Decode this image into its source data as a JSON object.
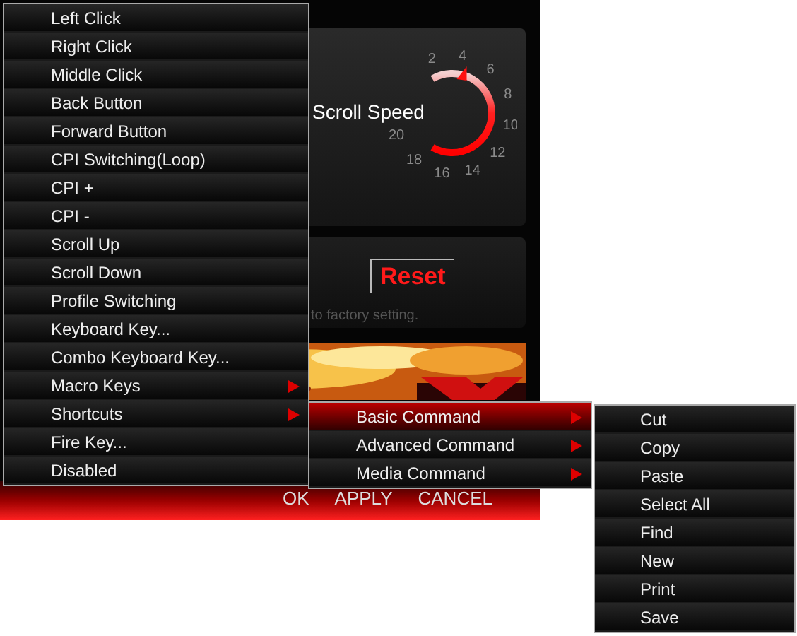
{
  "app": {
    "scroll_speed": {
      "label": "Scroll Speed",
      "ticks": [
        "2",
        "4",
        "6",
        "8",
        "10",
        "12",
        "14",
        "16",
        "18",
        "20"
      ]
    },
    "reset_button": "Reset",
    "reset_hint": "to factory setting.",
    "buttons": [
      "OK",
      "APPLY",
      "CANCEL"
    ]
  },
  "menu": {
    "items": [
      {
        "label": "Left Click",
        "has_submenu": false
      },
      {
        "label": "Right Click",
        "has_submenu": false
      },
      {
        "label": "Middle Click",
        "has_submenu": false
      },
      {
        "label": "Back Button",
        "has_submenu": false
      },
      {
        "label": "Forward Button",
        "has_submenu": false
      },
      {
        "label": "CPI Switching(Loop)",
        "has_submenu": false
      },
      {
        "label": "CPI +",
        "has_submenu": false
      },
      {
        "label": "CPI -",
        "has_submenu": false
      },
      {
        "label": "Scroll Up",
        "has_submenu": false
      },
      {
        "label": "Scroll Down",
        "has_submenu": false
      },
      {
        "label": "Profile Switching",
        "has_submenu": false
      },
      {
        "label": "Keyboard Key...",
        "has_submenu": false
      },
      {
        "label": "Combo Keyboard Key...",
        "has_submenu": false
      },
      {
        "label": "Macro Keys",
        "has_submenu": true
      },
      {
        "label": "Shortcuts",
        "has_submenu": true
      },
      {
        "label": "Fire Key...",
        "has_submenu": false
      },
      {
        "label": "Disabled",
        "has_submenu": false
      }
    ]
  },
  "shortcuts_submenu": {
    "items": [
      {
        "label": "Basic Command",
        "has_submenu": true,
        "selected": true
      },
      {
        "label": "Advanced Command",
        "has_submenu": true,
        "selected": false
      },
      {
        "label": "Media Command",
        "has_submenu": true,
        "selected": false
      }
    ]
  },
  "basic_command_submenu": {
    "items": [
      {
        "label": "Cut"
      },
      {
        "label": "Copy"
      },
      {
        "label": "Paste"
      },
      {
        "label": "Select All"
      },
      {
        "label": "Find"
      },
      {
        "label": "New"
      },
      {
        "label": "Print"
      },
      {
        "label": "Save"
      }
    ]
  }
}
